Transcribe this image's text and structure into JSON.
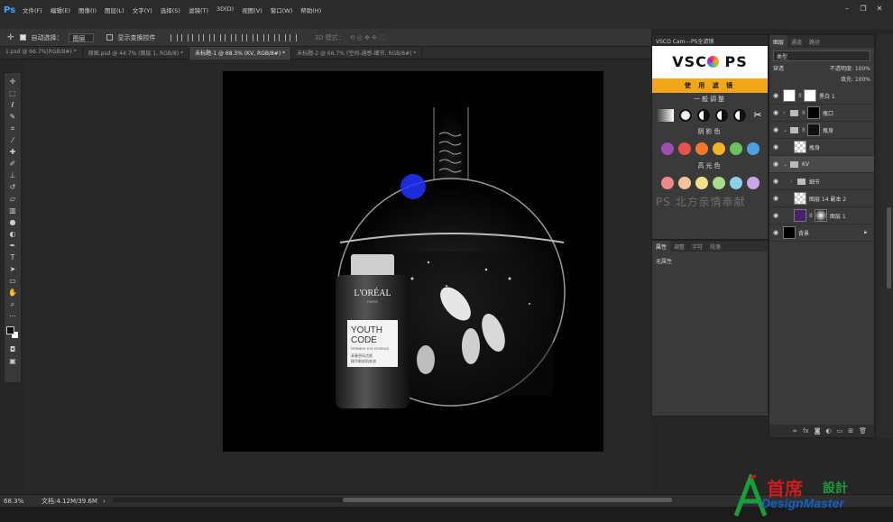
{
  "app": {
    "logo": "Ps"
  },
  "menu": [
    "文件(F)",
    "编辑(E)",
    "图像(I)",
    "图层(L)",
    "文字(Y)",
    "选择(S)",
    "滤镜(T)",
    "3D(D)",
    "视图(V)",
    "窗口(W)",
    "帮助(H)"
  ],
  "options": {
    "auto_select_label": "自动选择：",
    "auto_select_value": "图层",
    "show_transform_label": "显示变换控件",
    "mode_3d": "3D 模式："
  },
  "tabs": [
    "1.psd @ 66.7%(RGB/8#) *",
    "原图.psd @ 44.7% (图层 1, RGB/8) *",
    "未标题-1 @ 68.3% (KV, RGB/8#) *",
    "未标题-2 @ 66.7% (空间-通感-细节, RGB/8#) *"
  ],
  "canvas_art": {
    "brand": "L'ORÉAL",
    "brand_sub": "PARIS",
    "product_line1": "YOUTH",
    "product_line2": "CODE",
    "product_desc": "FERMENT EYE ESSENCE",
    "product_cn1": "青春密码活颜",
    "product_cn2": "精华眼部肌底液"
  },
  "status": {
    "zoom": "68.3%",
    "doc_info": "文档:4.12M/39.6M"
  },
  "vsco": {
    "panel_title": "VSCO Cam---PS全滤镜",
    "logo_left": "VSC",
    "logo_right": "PS",
    "apply_label": "使 用 滤 镜",
    "section_general": "一般调整",
    "section_shadow": "阴影色",
    "section_highlight": "高光色",
    "shadow_colors": [
      "#9b4fb0",
      "#e8524a",
      "#f07a2a",
      "#f5b32a",
      "#6ac25b",
      "#4aa3e0"
    ],
    "highlight_colors": [
      "#f08a8a",
      "#f3c49a",
      "#f3e08a",
      "#a6dc8a",
      "#8ad0e8",
      "#c9a6e8"
    ],
    "credit": "PS 北方亲情奉献"
  },
  "properties": {
    "tabs": [
      "属性",
      "调整",
      "字符",
      "段落"
    ],
    "content": "无属性"
  },
  "layers": {
    "tabs": [
      "图层",
      "通道",
      "路径"
    ],
    "filter_label": "类型",
    "blend_mode": "穿透",
    "opacity_label": "不透明度: 100%",
    "fill_label": "填充: 100%",
    "rows": [
      {
        "name": "黑白 1",
        "kind": "adjustment"
      },
      {
        "name": "瓶口",
        "kind": "group"
      },
      {
        "name": "瓶身",
        "kind": "group"
      },
      {
        "name": "瓶身",
        "kind": "layer"
      },
      {
        "name": "KV",
        "kind": "group"
      },
      {
        "name": "细节",
        "kind": "group"
      },
      {
        "name": "图层 14 副本 2",
        "kind": "layer"
      },
      {
        "name": "图层 1",
        "kind": "layer"
      },
      {
        "name": "背景",
        "kind": "layer"
      }
    ]
  },
  "watermark": {
    "title_red": "首席",
    "title_green": "設計",
    "subtitle": "DesignMaster"
  }
}
